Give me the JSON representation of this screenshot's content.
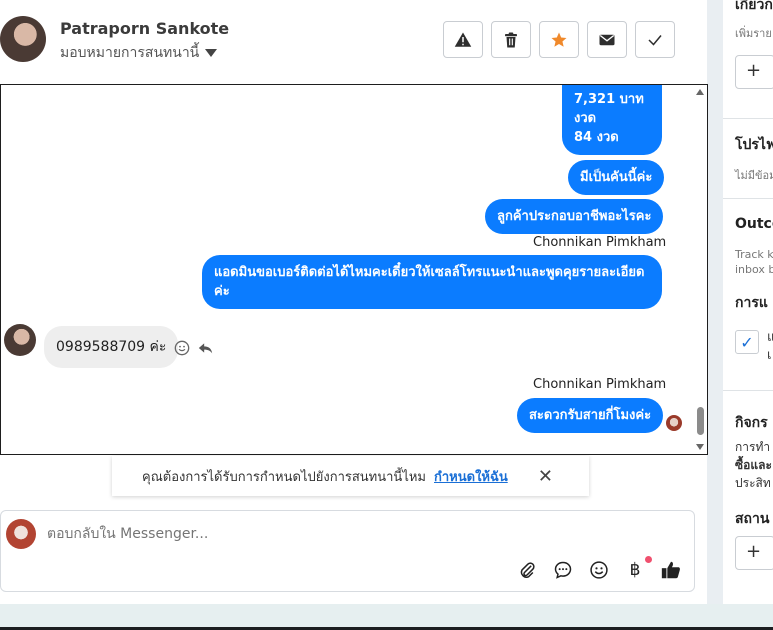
{
  "header": {
    "contact_name": "Patraporn Sankote",
    "assign_label": "มอบหมายการสนทนานี้"
  },
  "toolbar": {
    "icons": [
      "warning-icon",
      "trash-icon",
      "star-icon",
      "envelope-icon",
      "check-icon"
    ],
    "star_color": "#f0892b"
  },
  "messages": {
    "m1_lines": [
      "7,321 บาท",
      "งวด",
      "84 งวด"
    ],
    "m2": "มีเป็นคันนี้ค่ะ",
    "m3": "ลูกค้าประกอบอาชีพอะไรคะ",
    "sender1": "Chonnikan Pimkham",
    "m4_line1": "แอดมินขอเบอร์ติดต่อได้ไหมคะเดี๋ยวให้เซลล์โทรแนะนำและพูดคุยรายละเอียด",
    "m4_line2": "ค่ะ",
    "incoming": "0989588709 ค่ะ",
    "sender2": "Chonnikan Pimkham",
    "m5": "สะดวกรับสายกี่โมงค่ะ"
  },
  "reminder": {
    "text": "คุณต้องการได้รับการกำหนดไปยังการสนทนานี้ไหม",
    "link": "กำหนดให้ฉัน",
    "close": "✕"
  },
  "composer": {
    "placeholder": "ตอบกลับใน Messenger...",
    "icons": [
      "paperclip-icon",
      "chat-bubble-icon",
      "emoji-icon",
      "baht-icon",
      "thumbs-up-icon"
    ],
    "baht_glyph": "฿"
  },
  "right_panel": {
    "title_top": "เกี่ยวก",
    "sub_top": "เพิ่มราย",
    "btn_plus": "+",
    "section2_title": "โปรไฟ",
    "section2_sub": "ไม่มีข้อม",
    "section3_title": "Outco",
    "section3_sub1": "Track k",
    "section3_sub2": "inbox b",
    "section3_sub3": "การแ",
    "check_text1": "แ",
    "check_text2": "เ",
    "section4_title": "กิจกร",
    "section4_l1": "การทำ",
    "section4_l2": "ซื้อและ",
    "section4_l3": "ประสิท",
    "section5_title": "สถาน",
    "btn_plus2": "+"
  },
  "colors": {
    "accent_blue": "#0b7cff",
    "link_blue": "#1a6fd6",
    "notif_red": "#f0506e"
  }
}
